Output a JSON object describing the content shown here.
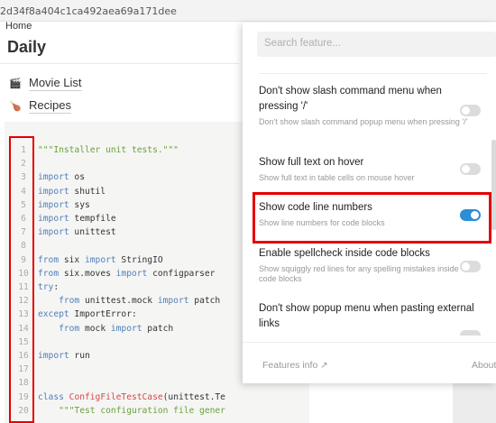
{
  "page_id": "2d34f8a404c1ca492aea69a171dee",
  "breadcrumb": "Home",
  "title": "Daily",
  "links": [
    {
      "icon": "clapper-icon",
      "glyph": "🎬",
      "label": "Movie List"
    },
    {
      "icon": "drumstick-icon",
      "glyph": "🍗",
      "label": "Recipes"
    }
  ],
  "code": {
    "lines": [
      {
        "n": "1",
        "parts": [
          [
            "str",
            "\"\"\"Installer unit tests.\"\"\""
          ]
        ]
      },
      {
        "n": "2",
        "parts": []
      },
      {
        "n": "3",
        "parts": [
          [
            "kw",
            "import"
          ],
          [
            "",
            " os"
          ]
        ]
      },
      {
        "n": "4",
        "parts": [
          [
            "kw",
            "import"
          ],
          [
            "",
            " shutil"
          ]
        ]
      },
      {
        "n": "5",
        "parts": [
          [
            "kw",
            "import"
          ],
          [
            "",
            " sys"
          ]
        ]
      },
      {
        "n": "6",
        "parts": [
          [
            "kw",
            "import"
          ],
          [
            "",
            " tempfile"
          ]
        ]
      },
      {
        "n": "7",
        "parts": [
          [
            "kw",
            "import"
          ],
          [
            "",
            " unittest"
          ]
        ]
      },
      {
        "n": "8",
        "parts": []
      },
      {
        "n": "9",
        "parts": [
          [
            "kw",
            "from"
          ],
          [
            "",
            " six "
          ],
          [
            "kw",
            "import"
          ],
          [
            "",
            " StringIO"
          ]
        ]
      },
      {
        "n": "10",
        "parts": [
          [
            "kw",
            "from"
          ],
          [
            "",
            " six.moves "
          ],
          [
            "kw",
            "import"
          ],
          [
            "",
            " configparser"
          ]
        ]
      },
      {
        "n": "11",
        "parts": [
          [
            "kw",
            "try"
          ],
          [
            "",
            ":"
          ]
        ]
      },
      {
        "n": "12",
        "parts": [
          [
            "",
            "    "
          ],
          [
            "kw",
            "from"
          ],
          [
            "",
            " unittest.mock "
          ],
          [
            "kw",
            "import"
          ],
          [
            "",
            " patch"
          ]
        ]
      },
      {
        "n": "13",
        "parts": [
          [
            "kw",
            "except"
          ],
          [
            "",
            " ImportError:"
          ]
        ]
      },
      {
        "n": "14",
        "parts": [
          [
            "",
            "    "
          ],
          [
            "kw",
            "from"
          ],
          [
            "",
            " mock "
          ],
          [
            "kw",
            "import"
          ],
          [
            "",
            " patch"
          ]
        ]
      },
      {
        "n": "15",
        "parts": []
      },
      {
        "n": "16",
        "parts": [
          [
            "kw",
            "import"
          ],
          [
            "",
            " run"
          ]
        ]
      },
      {
        "n": "17",
        "parts": []
      },
      {
        "n": "18",
        "parts": []
      },
      {
        "n": "19",
        "parts": [
          [
            "kw",
            "class"
          ],
          [
            "",
            " "
          ],
          [
            "cls",
            "ConfigFileTestCase"
          ],
          [
            "",
            "(unittest.Te"
          ]
        ]
      },
      {
        "n": "20",
        "parts": [
          [
            "",
            "    "
          ],
          [
            "str",
            "\"\"\"Test configuration file gener"
          ]
        ]
      }
    ]
  },
  "panel": {
    "search_placeholder": "Search feature...",
    "items": [
      {
        "title": "Don't show slash command menu when pressing '/'",
        "desc": "Don't show slash command popup menu when pressing '/'",
        "on": false
      },
      {
        "title": "Show full text on hover",
        "desc": "Show full text in table cells on mouse hover",
        "on": false
      },
      {
        "title": "Show code line numbers",
        "desc": "Show line numbers for code blocks",
        "on": true
      },
      {
        "title": "Enable spellcheck inside code blocks",
        "desc": "Show squiggly red lines for any spelling mistakes inside code blocks",
        "on": false
      },
      {
        "title": "Don't show popup menu when pasting external links",
        "desc": "",
        "on": false
      }
    ],
    "features_info": "Features info",
    "ext_glyph": "↗",
    "about": "About"
  },
  "colors": {
    "accent": "#2a8fd6",
    "highlight": "#e40000",
    "keyword": "#4f7fb8",
    "string": "#6aa23a",
    "class_name": "#d34a4a"
  }
}
